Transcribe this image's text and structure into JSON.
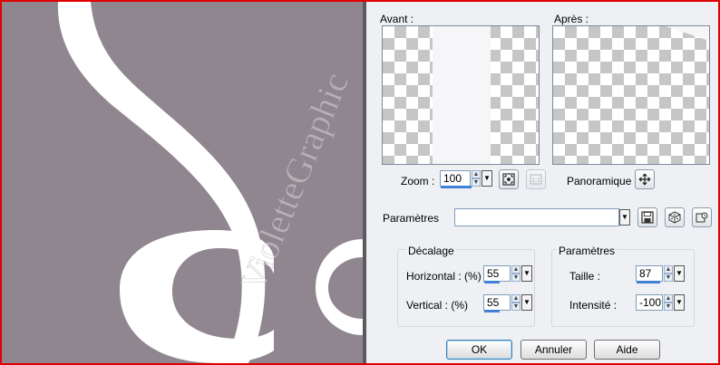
{
  "colors": {
    "canvas_bg": "#908690",
    "shape_white": "#ffffff",
    "panel_bg": "#eef0f4",
    "accent_blue": "#3f82d6",
    "frame_red": "#e00000"
  },
  "canvas": {
    "watermark": "VioletteGraphic"
  },
  "preview": {
    "before_label": "Avant :",
    "after_label": "Après :"
  },
  "zoom": {
    "label": "Zoom :",
    "value": "100",
    "fill_fraction": 1.0,
    "fit_icon": "fit-window-icon",
    "actual_size_icon": "actual-size-icon"
  },
  "pan": {
    "label": "Panoramique :",
    "icon": "move-arrows-icon"
  },
  "presets": {
    "label": "Paramètres",
    "value": "",
    "save_icon": "save-disk-icon",
    "random_icon": "dice-icon",
    "manage_icon": "preset-manager-icon"
  },
  "offset_group": {
    "title": "Décalage",
    "horizontal_label": "Horizontal : (%)",
    "horizontal_value": "55",
    "horizontal_fill": 0.55,
    "vertical_label": "Vertical : (%)",
    "vertical_value": "55",
    "vertical_fill": 0.55
  },
  "params_group": {
    "title": "Paramètres",
    "size_label": "Taille :",
    "size_value": "87",
    "size_fill": 0.87,
    "intensity_label": "Intensité :",
    "intensity_value": "-100",
    "intensity_fill": 0.0
  },
  "buttons": {
    "ok": "OK",
    "cancel": "Annuler",
    "help": "Aide"
  }
}
